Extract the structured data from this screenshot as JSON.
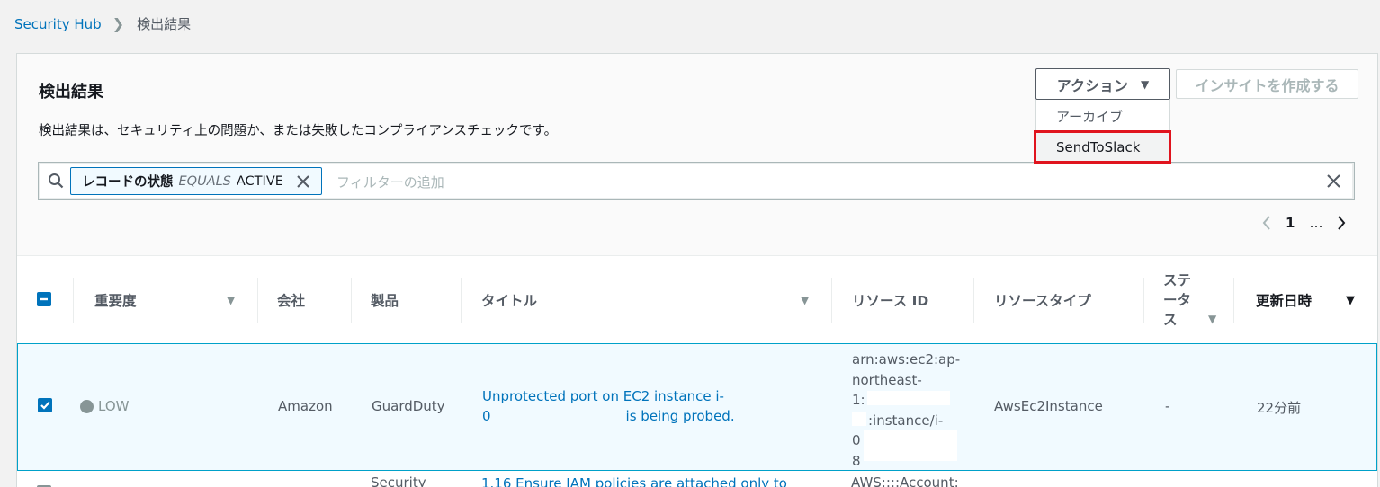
{
  "breadcrumb": {
    "root": "Security Hub",
    "current": "検出結果"
  },
  "header": {
    "title": "検出結果",
    "description": "検出結果は、セキュリティ上の問題か、または失敗したコンプライアンスチェックです。"
  },
  "actions": {
    "action_button": "アクション",
    "insight_button": "インサイトを作成する",
    "menu": [
      "アーカイブ",
      "SendToSlack"
    ]
  },
  "filter": {
    "token_key": "レコードの状態",
    "token_op": "EQUALS",
    "token_value": "ACTIVE",
    "placeholder": "フィルターの追加"
  },
  "pagination": {
    "page": "1",
    "ellipsis": "…"
  },
  "table": {
    "headers": [
      "重要度",
      "会社",
      "製品",
      "タイトル",
      "リソース ID",
      "リソースタイプ",
      "ステータス",
      "更新日時"
    ],
    "status_header_lines": [
      "ステ",
      "ータ",
      "ス"
    ],
    "row1": {
      "severity": "LOW",
      "company": "Amazon",
      "product": "GuardDuty",
      "title_line1": "Unprotected port on EC2 instance i-",
      "title_line2_start": "0",
      "title_line2_end": "is being probed.",
      "resource_lines": [
        "arn:aws:ec2:ap-",
        "northeast-",
        "1:",
        ":instance/i-",
        "0",
        "8"
      ],
      "resource_type": "AwsEc2Instance",
      "status": "-",
      "updated": "22分前"
    },
    "row2": {
      "product": "Security",
      "title": "1.16 Ensure IAM policies are attached only to",
      "resource": "AWS::::Account:"
    }
  },
  "colors": {
    "link": "#0073bb",
    "highlight": "#e0141e",
    "selected_row": "#f1faff"
  }
}
